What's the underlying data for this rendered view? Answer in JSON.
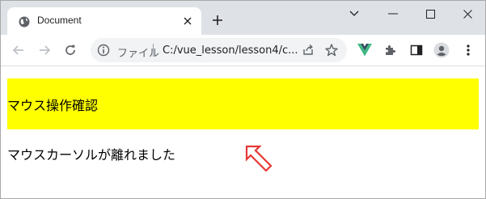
{
  "browser": {
    "tab": {
      "title": "Document",
      "favicon": "globe-icon"
    },
    "window_controls": [
      "chevron-down-icon",
      "minimize-icon",
      "maximize-icon",
      "close-icon"
    ],
    "toolbar": {
      "omnibox": {
        "site_label": "ファイル",
        "url": "C:/vue_lesson/lesson4/c..."
      }
    },
    "colors": {
      "tabstrip": "#dee1e6",
      "omnibox": "#f1f3f4",
      "vue_accent": "#41b883"
    }
  },
  "page": {
    "hover_box_text": "マウス操作確認",
    "status_text": "マウスカーソルが離れました",
    "colors": {
      "hover_box_bg": "#ffff00",
      "annotation_arrow": "#e53935"
    }
  }
}
